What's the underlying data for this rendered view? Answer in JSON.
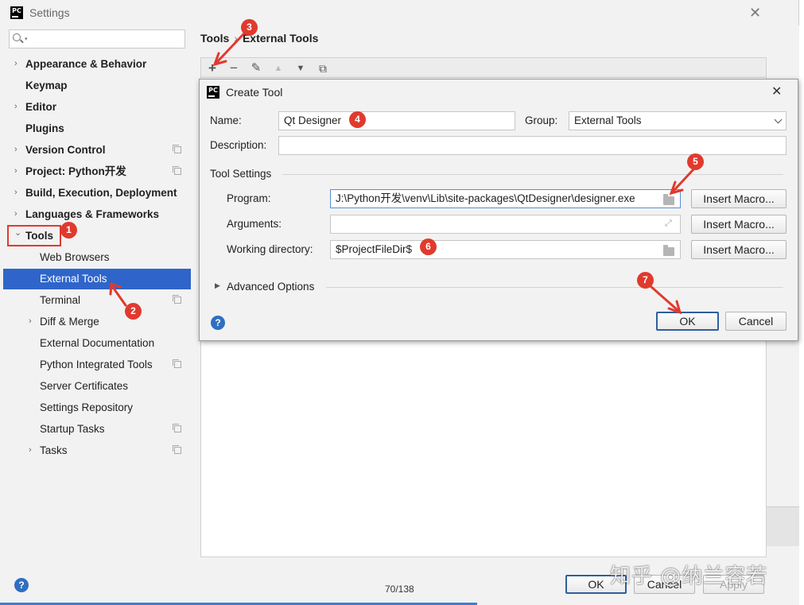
{
  "window": {
    "title": "Settings"
  },
  "search": {
    "placeholder": ""
  },
  "sidebar": {
    "items": [
      {
        "label": "Appearance & Behavior",
        "arrow": "›"
      },
      {
        "label": "Keymap"
      },
      {
        "label": "Editor",
        "arrow": "›"
      },
      {
        "label": "Plugins"
      },
      {
        "label": "Version Control",
        "arrow": "›"
      },
      {
        "label": "Project: Python开发",
        "arrow": "›"
      },
      {
        "label": "Build, Execution, Deployment",
        "arrow": "›"
      },
      {
        "label": "Languages & Frameworks",
        "arrow": "›"
      },
      {
        "label": "Tools",
        "arrow": "⌄"
      },
      {
        "label": "Web Browsers"
      },
      {
        "label": "External Tools"
      },
      {
        "label": "Terminal"
      },
      {
        "label": "Diff & Merge",
        "arrow": "›"
      },
      {
        "label": "External Documentation"
      },
      {
        "label": "Python Integrated Tools"
      },
      {
        "label": "Server Certificates"
      },
      {
        "label": "Settings Repository"
      },
      {
        "label": "Startup Tasks"
      },
      {
        "label": "Tasks",
        "arrow": "›"
      }
    ]
  },
  "breadcrumb": {
    "parent": "Tools",
    "separator": "›",
    "current": "External Tools"
  },
  "toolbar": {
    "add": "+",
    "remove": "−",
    "edit": "✎",
    "up": "▲",
    "down": "▼",
    "copy": "⧉"
  },
  "dialog": {
    "title": "Create Tool",
    "name_label": "Name:",
    "name_value": "Qt Designer",
    "group_label": "Group:",
    "group_value": "External Tools",
    "description_label": "Description:",
    "description_value": "",
    "tool_settings_label": "Tool Settings",
    "program_label": "Program:",
    "program_value": "J:\\Python开发\\venv\\Lib\\site-packages\\QtDesigner\\designer.exe",
    "arguments_label": "Arguments:",
    "arguments_value": "",
    "working_dir_label": "Working directory:",
    "working_dir_value": "$ProjectFileDir$",
    "insert_macro_label": "Insert Macro...",
    "advanced_label": "Advanced Options",
    "ok_label": "OK",
    "cancel_label": "Cancel",
    "help": "?"
  },
  "footer": {
    "ok_label": "OK",
    "cancel_label": "Cancel",
    "apply_label": "Apply",
    "help": "?"
  },
  "page_indicator": "70/138",
  "watermark": "知乎 @纳兰容若",
  "annotations": {
    "badges": [
      "1",
      "2",
      "3",
      "4",
      "5",
      "6",
      "7"
    ],
    "color": "#e03a2e"
  },
  "colors": {
    "selection": "#2f65ca",
    "help": "#2f6fc2",
    "default_button_border": "#2e5f9e"
  }
}
